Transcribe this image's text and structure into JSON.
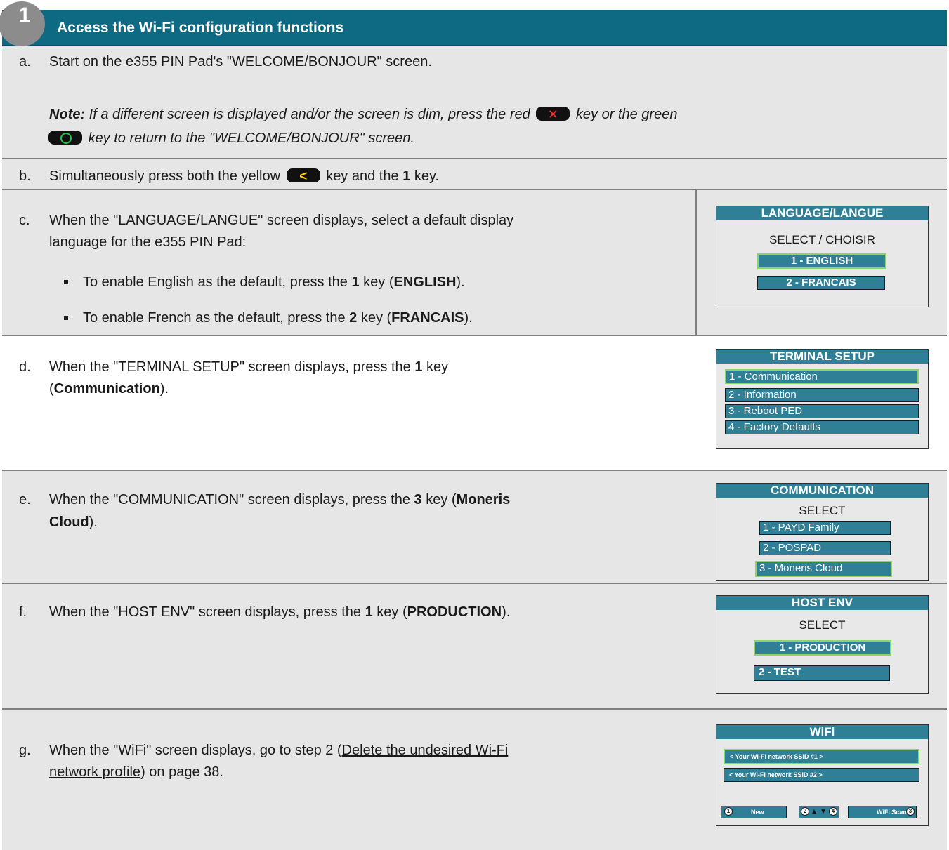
{
  "header": {
    "step_number": "1",
    "title": "Access the Wi-Fi configuration functions"
  },
  "steps": {
    "a": {
      "letter": "a.",
      "text": "Start on the e355 PIN Pad's \"WELCOME/BONJOUR\" screen.",
      "note_label": "Note:",
      "note_1": "If a different screen is displayed and/or the screen is dim, press the red",
      "note_2": "key or the green",
      "note_3": "key to return to the \"WELCOME/BONJOUR\" screen."
    },
    "b": {
      "letter": "b.",
      "text_1": "Simultaneously press both the yellow",
      "text_2": "key and the",
      "key": "1",
      "text_3": "key."
    },
    "c": {
      "letter": "c.",
      "line_1": "When the \"LANGUAGE/LANGUE\" screen displays, select a default display",
      "line_2": "language for the e355 PIN Pad:",
      "bullet_1_a": "To enable English as the default, press the",
      "bullet_1_key": "1",
      "bullet_1_b": "key (",
      "bullet_1_bold": "ENGLISH",
      "bullet_1_c": ").",
      "bullet_2_a": "To enable French as the default, press the",
      "bullet_2_key": "2",
      "bullet_2_b": "key (",
      "bullet_2_bold": "FRANCAIS",
      "bullet_2_c": ")."
    },
    "d": {
      "letter": "d.",
      "line_1_a": "When the \"TERMINAL SETUP\" screen displays, press the",
      "line_1_key": "1",
      "line_1_b": "key",
      "line_2_a": "(",
      "line_2_bold": "Communication",
      "line_2_b": ")."
    },
    "e": {
      "letter": "e.",
      "line_1_a": "When the \"COMMUNICATION\" screen displays, press the",
      "line_1_key": "3",
      "line_1_b": "key (",
      "line_1_bold": "Moneris",
      "line_2_bold": "Cloud",
      "line_2_b": ")."
    },
    "f": {
      "letter": "f.",
      "line_1_a": "When the \"HOST ENV\" screen displays, press the",
      "line_1_key": "1",
      "line_1_b": "key (",
      "line_1_bold": "PRODUCTION",
      "line_1_c": ")."
    },
    "g": {
      "letter": "g.",
      "line_1_a": "When the \"WiFi\" screen displays, go to step 2 (",
      "line_1_link": "Delete the undesired Wi-Fi",
      "line_2_link": "network profile",
      "line_2_b": ") on page 38."
    }
  },
  "screens": {
    "language": {
      "title": "LANGUAGE/LANGUE",
      "subtitle": "SELECT  / CHOISIR",
      "options": [
        "1 - ENGLISH",
        "2 - FRANCAIS"
      ]
    },
    "terminal": {
      "title": "TERMINAL SETUP",
      "options": [
        "1 - Communication",
        "2 - Information",
        "3 - Reboot PED",
        "4 - Factory Defaults"
      ]
    },
    "communication": {
      "title": "COMMUNICATION",
      "subtitle": "SELECT",
      "options": [
        "1 - PAYD Family",
        "2 - POSPAD",
        "3 - Moneris Cloud"
      ]
    },
    "hostenv": {
      "title": "HOST ENV",
      "subtitle": "SELECT",
      "options": [
        "1 - PRODUCTION",
        "2 - TEST"
      ]
    },
    "wifi": {
      "title": "WiFi",
      "options": [
        "< Your Wi-Fi network SSID #1 >",
        "< Your Wi-Fi network SSID #2 >"
      ],
      "softkey_new": "New",
      "softkey_scan": "WiFi Scan",
      "circ_1": "1",
      "circ_2": "2",
      "circ_3": "3",
      "circ_4": "4"
    }
  },
  "colors": {
    "header_bg": "#0d6a82",
    "screen_title_bg": "#2f7f96",
    "row_gray": "#e6e6e6",
    "selected_border": "#8bd36b"
  }
}
